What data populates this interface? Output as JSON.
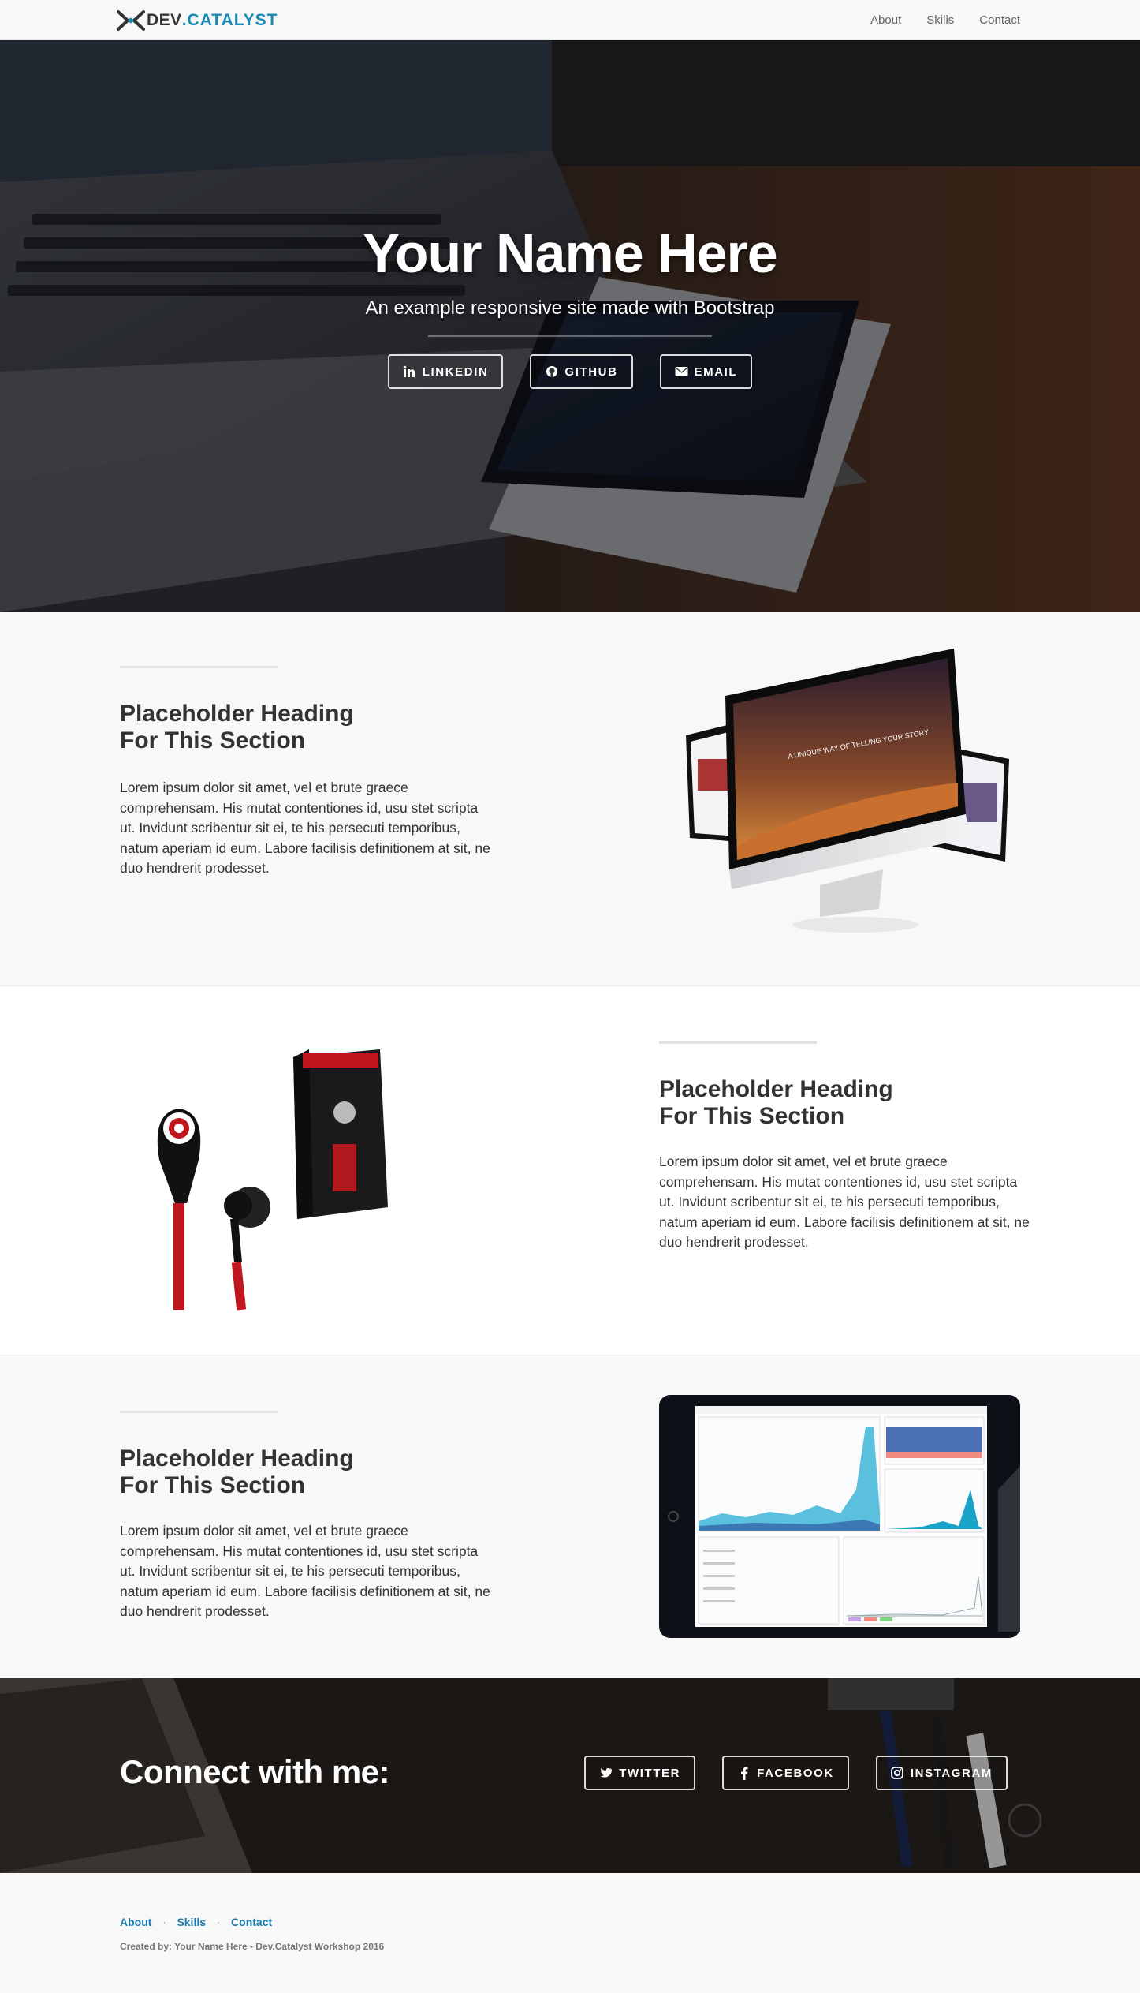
{
  "brand": {
    "prefix": "DEV",
    "dot": ".",
    "name": "CATALYST"
  },
  "nav": {
    "items": [
      {
        "label": "About"
      },
      {
        "label": "Skills"
      },
      {
        "label": "Contact"
      }
    ]
  },
  "hero": {
    "title": "Your Name Here",
    "subtitle": "An example responsive site made with Bootstrap",
    "buttons": [
      {
        "label": "LINKEDIN",
        "icon": "linkedin-icon"
      },
      {
        "label": "GITHUB",
        "icon": "github-icon"
      },
      {
        "label": "EMAIL",
        "icon": "envelope-icon"
      }
    ]
  },
  "sections": [
    {
      "heading_line1": "Placeholder Heading",
      "heading_line2": "For This Section",
      "text": "Lorem ipsum dolor sit amet, vel et brute graece comprehensam. His mutat contentiones id, usu stet scripta ut. Invidunt scribentur sit ei, te his persecuti temporibus, natum aperiam id eum. Labore facilisis definitionem at sit, ne duo hendrerit prodesset.",
      "image": "devices-mockup-image",
      "screen_text": "A UNIQUE WAY OF TELLING YOUR STORY"
    },
    {
      "heading_line1": "Placeholder Heading",
      "heading_line2": "For This Section",
      "text": "Lorem ipsum dolor sit amet, vel et brute graece comprehensam. His mutat contentiones id, usu stet scripta ut. Invidunt scribentur sit ei, te his persecuti temporibus, natum aperiam id eum. Labore facilisis definitionem at sit, ne duo hendrerit prodesset.",
      "image": "earphones-product-image"
    },
    {
      "heading_line1": "Placeholder Heading",
      "heading_line2": "For This Section",
      "text": "Lorem ipsum dolor sit amet, vel et brute graece comprehensam. His mutat contentiones id, usu stet scripta ut. Invidunt scribentur sit ei, te his persecuti temporibus, natum aperiam id eum. Labore facilisis definitionem at sit, ne duo hendrerit prodesset.",
      "image": "tablet-dashboard-image"
    }
  ],
  "connect": {
    "title": "Connect with me:",
    "buttons": [
      {
        "label": "TWITTER",
        "icon": "twitter-icon"
      },
      {
        "label": "FACEBOOK",
        "icon": "facebook-icon"
      },
      {
        "label": "INSTAGRAM",
        "icon": "instagram-icon"
      }
    ]
  },
  "footer": {
    "links": [
      {
        "label": "About"
      },
      {
        "label": "Skills"
      },
      {
        "label": "Contact"
      }
    ],
    "separator": "·",
    "credit": "Created by: Your Name Here - Dev.Catalyst Workshop 2016"
  },
  "colors": {
    "accent": "#1a8ab5",
    "link": "#1a7bb0",
    "text": "#333333",
    "background": "#f8f8f8"
  }
}
